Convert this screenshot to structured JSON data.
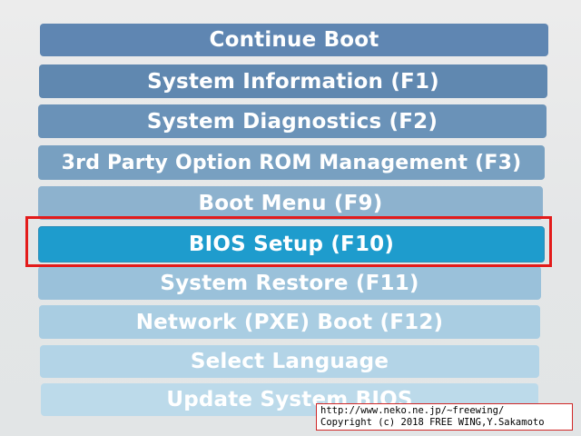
{
  "menu": {
    "items": [
      {
        "label": "Continue Boot"
      },
      {
        "label": "System Information (F1)"
      },
      {
        "label": "System Diagnostics (F2)"
      },
      {
        "label": "3rd Party Option ROM Management (F3)"
      },
      {
        "label": "Boot Menu (F9)"
      },
      {
        "label": "BIOS Setup (F10)",
        "selected": true
      },
      {
        "label": "System Restore (F11)"
      },
      {
        "label": "Network (PXE) Boot (F12)"
      },
      {
        "label": "Select Language"
      },
      {
        "label": "Update System BIOS"
      }
    ]
  },
  "overlay": {
    "url": "http://www.neko.ne.jp/~freewing/",
    "copyright": "Copyright (c) 2018 FREE WING,Y.Sakamoto"
  },
  "colors": {
    "selected": "#1e9ccd",
    "highlight_frame": "#e31b1b",
    "item_top": "#5f86b2",
    "item_bottom": "#bcdaea"
  }
}
